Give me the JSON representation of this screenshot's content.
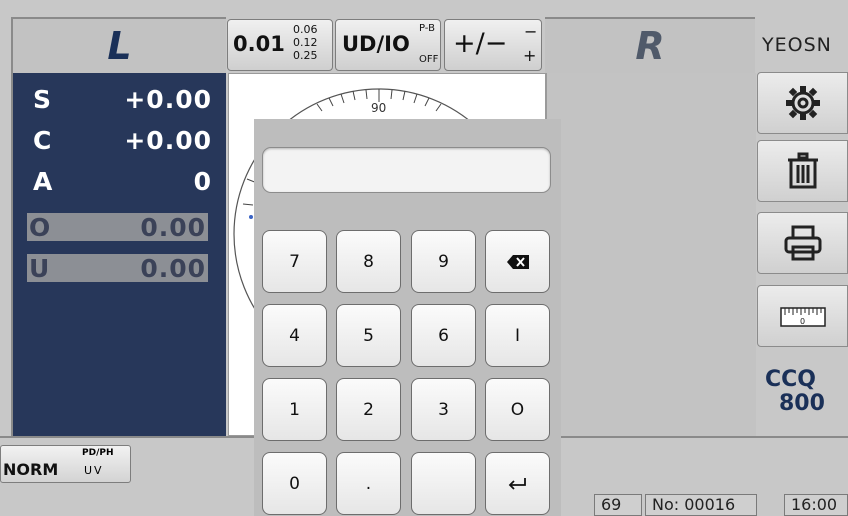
{
  "header": {
    "left_label": "L",
    "right_label": "R",
    "brand": "YEOSN",
    "acuity_button": {
      "main": "0.01",
      "stack": [
        "0.06",
        "0.12",
        "0.25"
      ]
    },
    "udio_button": {
      "main": "UD/IO",
      "sup": "P-B",
      "sub": "OFF"
    },
    "sign_button": {
      "main": "+/−",
      "minus": "−",
      "plus": "+"
    }
  },
  "left_panel": {
    "rows": [
      {
        "key": "S",
        "value": "+0.00"
      },
      {
        "key": "C",
        "value": "+0.00"
      },
      {
        "key": "A",
        "value": "0"
      },
      {
        "key": "O",
        "value": "0.00"
      },
      {
        "key": "U",
        "value": "0.00"
      }
    ]
  },
  "chart": {
    "top_label": "90"
  },
  "tools": [
    "gear-icon",
    "trash-icon",
    "printer-icon",
    "ruler-icon"
  ],
  "model": {
    "line1": "CCQ",
    "line2": "800"
  },
  "bottom": {
    "norm_button": {
      "main": "NORM",
      "top": "PD/PH",
      "bottom": "UV"
    },
    "fields": [
      "69",
      "No: 00016",
      "16:00"
    ]
  },
  "keypad": {
    "display_value": "",
    "keys": [
      [
        "7",
        "8",
        "9",
        "backspace"
      ],
      [
        "4",
        "5",
        "6",
        "I"
      ],
      [
        "1",
        "2",
        "3",
        "O"
      ],
      [
        "0",
        ".",
        "",
        "enter"
      ]
    ]
  },
  "colors": {
    "panel_blue": "#27375a",
    "label_blue": "#1a3058",
    "background": "#c8c8c8"
  }
}
